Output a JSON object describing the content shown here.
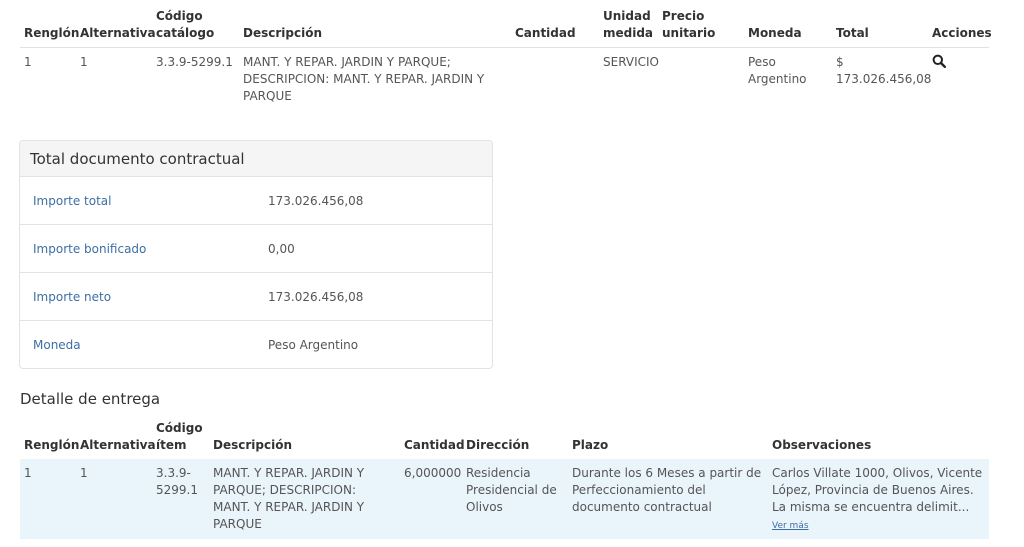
{
  "items_table": {
    "headers": {
      "renglon": "Renglón",
      "alternativa": "Alternativa",
      "codigo_line1": "Código",
      "codigo_line2": "catálogo",
      "descripcion": "Descripción",
      "cantidad": "Cantidad",
      "unidad_line1": "Unidad",
      "unidad_line2": "medida",
      "precio_line1": "Precio",
      "precio_line2": "unitario",
      "moneda": "Moneda",
      "total": "Total",
      "acciones": "Acciones"
    },
    "rows": [
      {
        "renglon": "1",
        "alternativa": "1",
        "codigo": "3.3.9-5299.1",
        "descripcion": "MANT. Y REPAR. JARDIN Y PARQUE; DESCRIPCION: MANT. Y REPAR. JARDIN Y PARQUE",
        "cantidad": "",
        "unidad": "SERVICIO",
        "precio": "",
        "moneda": "Peso Argentino",
        "total_symbol": "$",
        "total_value": "173.026.456,08",
        "action_icon": "search-icon"
      }
    ]
  },
  "total_card": {
    "title": "Total documento contractual",
    "rows": [
      {
        "label": "Importe total",
        "value": "173.026.456,08"
      },
      {
        "label": "Importe bonificado",
        "value": "0,00"
      },
      {
        "label": "Importe neto",
        "value": "173.026.456,08"
      },
      {
        "label": "Moneda",
        "value": "Peso Argentino"
      }
    ]
  },
  "delivery": {
    "title": "Detalle de entrega",
    "headers": {
      "renglon": "Renglón",
      "alternativa": "Alternativa",
      "codigo_line1": "Código",
      "codigo_line2": "ítem",
      "descripcion": "Descripción",
      "cantidad": "Cantidad",
      "direccion": "Dirección",
      "plazo": "Plazo",
      "observaciones": "Observaciones"
    },
    "rows": [
      {
        "renglon": "1",
        "alternativa": "1",
        "codigo": "3.3.9-5299.1",
        "descripcion": "MANT. Y REPAR. JARDIN Y PARQUE; DESCRIPCION: MANT. Y REPAR. JARDIN Y PARQUE",
        "cantidad": "6,000000",
        "direccion": "Residencia Presidencial de Olivos",
        "plazo": "Durante los 6 Meses a partir de Perfeccionamiento del documento contractual",
        "observaciones": "Carlos Villate 1000, Olivos, Vicente López, Provincia de Buenos Aires. La misma se encuentra delimit...",
        "ver_mas": "Ver más"
      }
    ]
  },
  "colors": {
    "link": "#3d6fa5",
    "row_highlight": "#eaf4fb",
    "card_header_bg": "#f5f5f5"
  }
}
